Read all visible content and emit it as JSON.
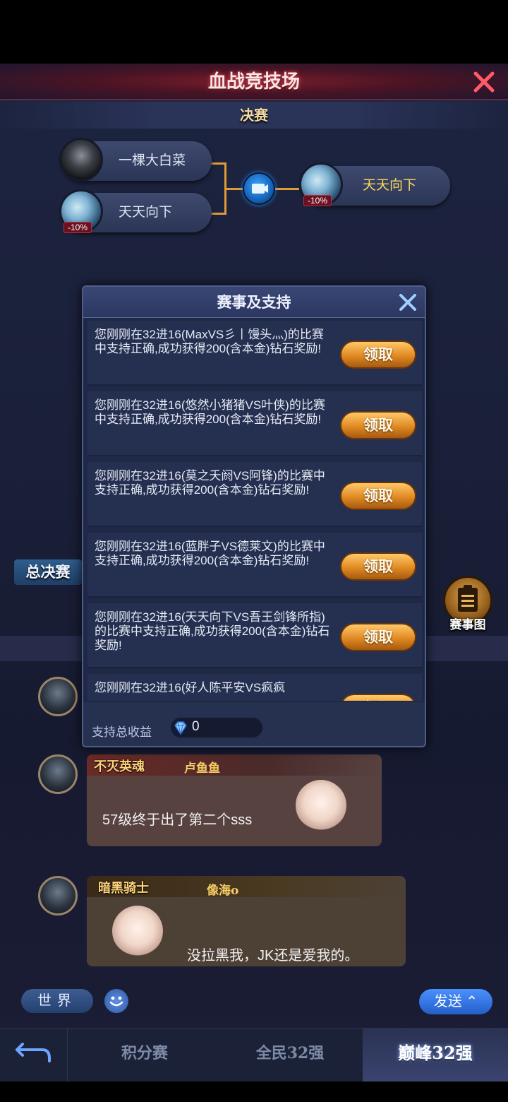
{
  "header": {
    "title": "血战竞技场",
    "subtitle": "决赛"
  },
  "bracket": {
    "player1": {
      "name": "一棵大白菜"
    },
    "player2": {
      "name": "天天向下",
      "badge": "-10%"
    },
    "winner": {
      "name": "天天向下",
      "badge": "-10%"
    }
  },
  "side": {
    "finals_label": "总决赛",
    "bracket_label": "赛事图"
  },
  "modal": {
    "title": "赛事及支持",
    "claim_label": "领取",
    "items": [
      {
        "text": "您刚刚在32进16(MaxVS彡丨馒头灬)的比赛中支持正确,成功获得200(含本金)钻石奖励!"
      },
      {
        "text": "您刚刚在32进16(悠然小猪猪VS叶侠)的比赛中支持正确,成功获得200(含本金)钻石奖励!"
      },
      {
        "text": "您刚刚在32进16(莫之夭阏VS阿锋)的比赛中支持正确,成功获得200(含本金)钻石奖励!"
      },
      {
        "text": "您刚刚在32进16(蓝胖子VS德莱文)的比赛中支持正确,成功获得200(含本金)钻石奖励!"
      },
      {
        "text": "您刚刚在32进16(天天向下VS吾王剑锋所指)的比赛中支持正确,成功获得200(含本金)钻石奖励!"
      },
      {
        "text": "您刚刚在32进16(好人陈平安VS疯疯"
      }
    ],
    "footer_label": "支持总收益",
    "footer_value": "0"
  },
  "chat": {
    "messages": [
      {
        "title": "不灭英魂",
        "name": "卢鱼鱼",
        "text": "57级终于出了第二个sss"
      },
      {
        "title": "暗黑骑士",
        "name": "像海o",
        "text": "没拉黑我，JK还是爱我的。"
      }
    ],
    "channel": "世界",
    "send": "发送"
  },
  "nav": {
    "tab1": "积分赛",
    "tab2": "全民32强",
    "tab3": "巅峰32强"
  },
  "colors": {
    "accent_gold": "#e09a3a",
    "claim_orange": "#e08a22",
    "bg": "#1d2440"
  }
}
